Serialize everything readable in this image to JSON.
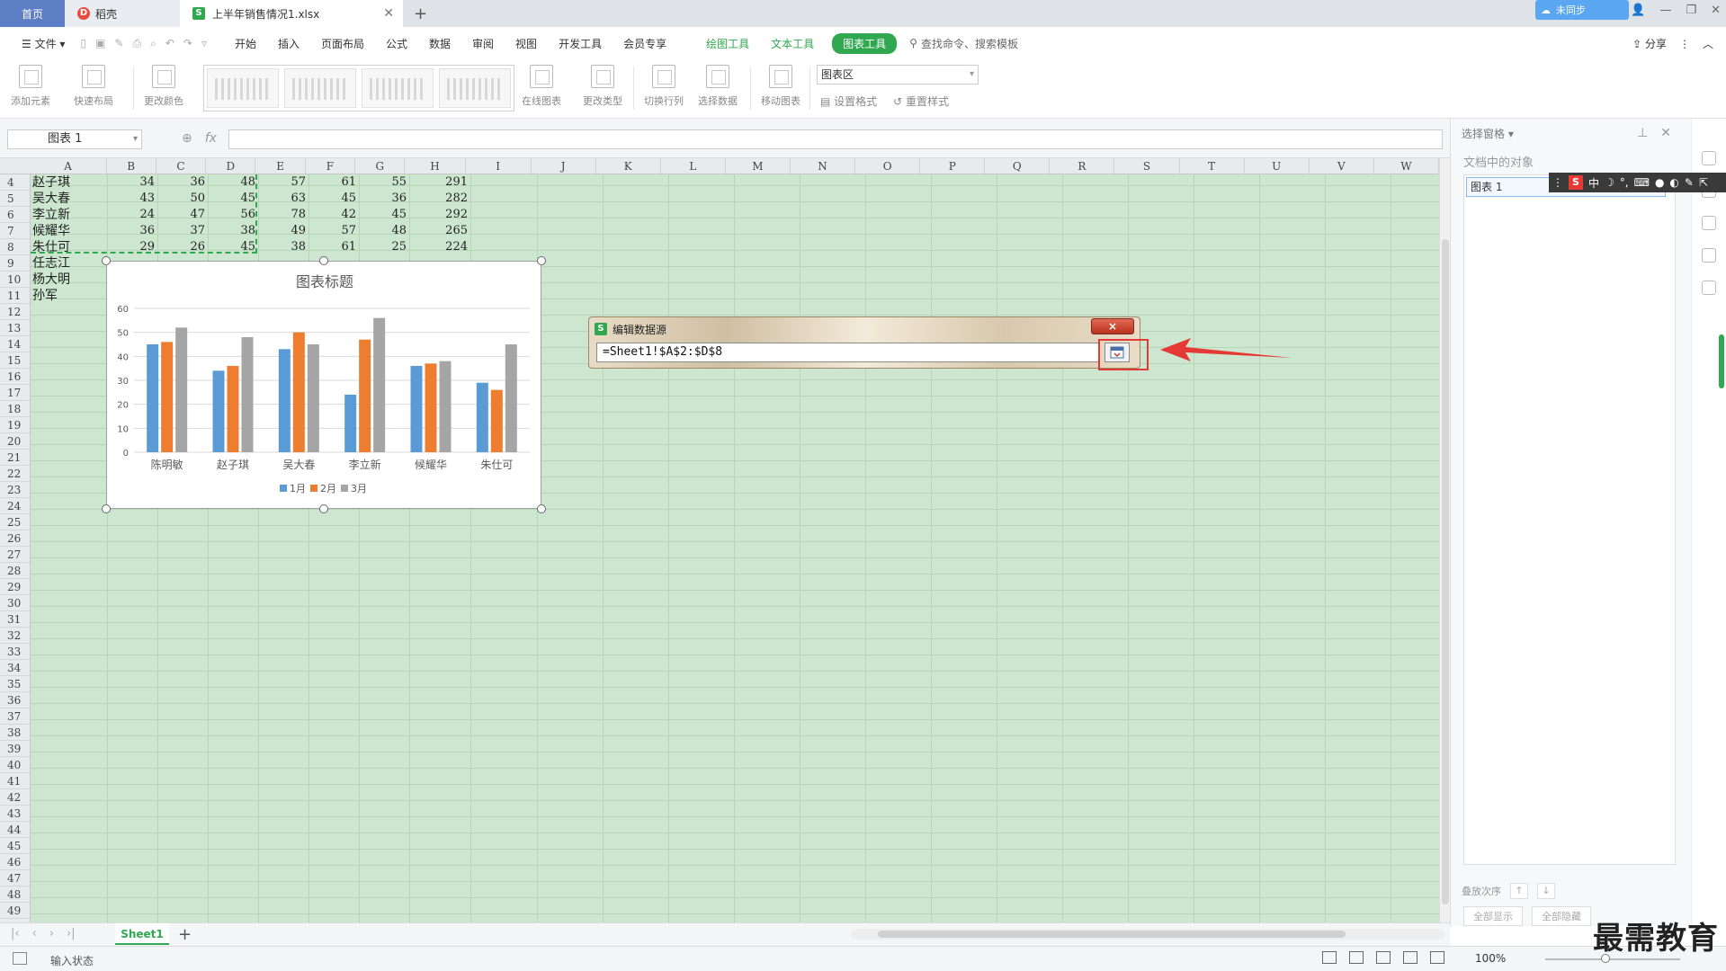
{
  "tabs": {
    "home": "首页",
    "daoke": "稻壳",
    "file": "上半年销售情况1.xlsx",
    "add": "+"
  },
  "menu": {
    "file": "文件",
    "items": [
      "开始",
      "插入",
      "页面布局",
      "公式",
      "数据",
      "审阅",
      "视图",
      "开发工具",
      "会员专享"
    ],
    "green_items": [
      "绘图工具",
      "文本工具"
    ],
    "active_item": "图表工具",
    "search": "查找命令、搜索模板",
    "cloud": "未同步",
    "share": "分享"
  },
  "ribbon": {
    "add_element": "添加元素",
    "quick_layout": "快速布局",
    "change_color": "更改颜色",
    "online_chart": "在线图表",
    "change_type": "更改类型",
    "switch_rowcol": "切换行列",
    "select_data": "选择数据",
    "move_chart": "移动图表",
    "element_select": "图表区",
    "set_format": "设置格式",
    "reset_style": "重置样式"
  },
  "formula": {
    "namebox": "图表 1",
    "fx": "fx"
  },
  "columns": [
    "A",
    "B",
    "C",
    "D",
    "E",
    "F",
    "G",
    "H",
    "I",
    "J",
    "K",
    "L",
    "M",
    "N",
    "O",
    "P",
    "Q",
    "R",
    "S",
    "T",
    "U",
    "V",
    "W"
  ],
  "first_row": 4,
  "last_row": 49,
  "rows": [
    {
      "name": "赵子琪",
      "vals": [
        "34",
        "36",
        "48",
        "57",
        "61",
        "55",
        "291"
      ]
    },
    {
      "name": "吴大春",
      "vals": [
        "43",
        "50",
        "45",
        "63",
        "45",
        "36",
        "282"
      ]
    },
    {
      "name": "李立新",
      "vals": [
        "24",
        "47",
        "56",
        "78",
        "42",
        "45",
        "292"
      ]
    },
    {
      "name": "候耀华",
      "vals": [
        "36",
        "37",
        "38",
        "49",
        "57",
        "48",
        "265"
      ]
    },
    {
      "name": "朱仕可",
      "vals": [
        "29",
        "26",
        "45",
        "38",
        "61",
        "25",
        "224"
      ]
    },
    {
      "name": "任志江",
      "vals": []
    },
    {
      "name": "杨大明",
      "vals": []
    },
    {
      "name": "孙军",
      "vals": []
    }
  ],
  "chart_data": {
    "type": "bar",
    "title": "图表标题",
    "categories": [
      "陈明敏",
      "赵子琪",
      "吴大春",
      "李立新",
      "候耀华",
      "朱仕可"
    ],
    "series": [
      {
        "name": "1月",
        "values": [
          45,
          34,
          43,
          24,
          36,
          29
        ],
        "color": "#5b9bd5"
      },
      {
        "name": "2月",
        "values": [
          46,
          36,
          50,
          47,
          37,
          26
        ],
        "color": "#ed7d31"
      },
      {
        "name": "3月",
        "values": [
          52,
          48,
          45,
          56,
          38,
          45
        ],
        "color": "#a5a5a5"
      }
    ],
    "ylim": [
      0,
      60
    ],
    "yticks": [
      0,
      10,
      20,
      30,
      40,
      50,
      60
    ],
    "grid": true,
    "legend": "bottom"
  },
  "dialog": {
    "title": "编辑数据源",
    "close": "×",
    "reference": "=Sheet1!$A$2:$D$8"
  },
  "pane": {
    "title": "选择窗格",
    "objects_label": "文档中的对象",
    "item": "图表 1",
    "order_label": "叠放次序",
    "show_all": "全部显示",
    "hide_all": "全部隐藏"
  },
  "ime": {
    "logo": "S",
    "mode": "中"
  },
  "sheet": {
    "tab": "Sheet1",
    "add": "+"
  },
  "status": {
    "state": "输入状态",
    "zoom": "100%",
    "lang": "中"
  },
  "watermark": "最需教育",
  "colors": {
    "accent": "#2fa84f",
    "highlight": "#e53935",
    "grid_bg": "#cde6cf"
  }
}
